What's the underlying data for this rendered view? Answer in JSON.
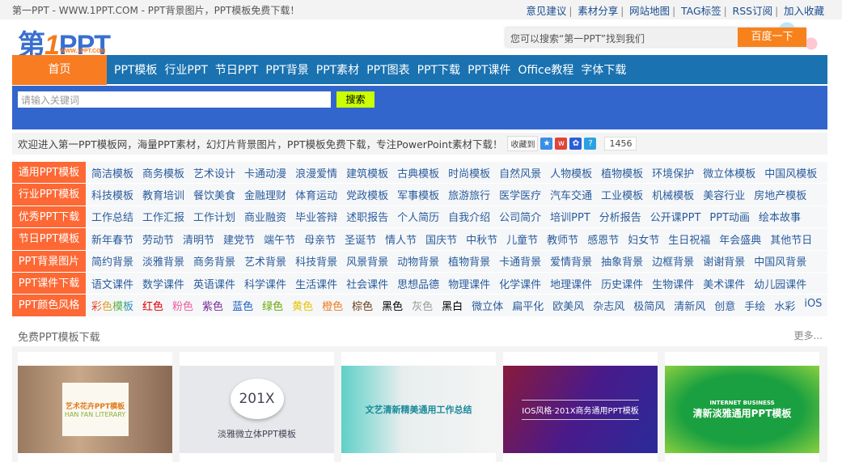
{
  "topbar": {
    "title": "第一PPT - WWW.1PPT.COM - PPT背景图片，PPT模板免费下载！",
    "links": [
      "意见建议",
      "素材分享",
      "网站地图",
      "TAG标签",
      "RSS订阅",
      "加入收藏"
    ]
  },
  "logo": {
    "text_a": "第",
    "text_b": "1",
    "text_c": "PPT",
    "sub": "WWW.1PPT.COM"
  },
  "baidu": {
    "placeholder": "您可以搜索“第一PPT”找到我们",
    "button": "百度一下"
  },
  "nav": {
    "home": "首页",
    "items": [
      "PPT模板",
      "行业PPT",
      "节日PPT",
      "PPT背景",
      "PPT素材",
      "PPT图表",
      "PPT下载",
      "PPT课件",
      "Office教程",
      "字体下载"
    ]
  },
  "search": {
    "placeholder": "请输入关键词",
    "button": "搜索"
  },
  "welcome": {
    "text": "欢迎进入第一PPT模板网，海量PPT素材，幻灯片背景图片，PPT模板免费下载，专注PowerPoint素材下载！",
    "fav": "收藏到",
    "count": "1456"
  },
  "categories": [
    {
      "label": "通用PPT模板",
      "links": [
        "简洁模板",
        "商务模板",
        "艺术设计",
        "卡通动漫",
        "浪漫爱情",
        "建筑模板",
        "古典模板",
        "时尚模板",
        "自然风景",
        "人物模板",
        "植物模板",
        "环境保护",
        "微立体模板",
        "中国风模板"
      ]
    },
    {
      "label": "行业PPT模板",
      "links": [
        "科技模板",
        "教育培训",
        "餐饮美食",
        "金融理财",
        "体育运动",
        "党政模板",
        "军事模板",
        "旅游旅行",
        "医学医疗",
        "汽车交通",
        "工业模板",
        "机械模板",
        "美容行业",
        "房地产模板"
      ]
    },
    {
      "label": "优秀PPT下载",
      "links": [
        "工作总结",
        "工作汇报",
        "工作计划",
        "商业融资",
        "毕业答辩",
        "述职报告",
        "个人简历",
        "自我介绍",
        "公司简介",
        "培训PPT",
        "分析报告",
        "公开课PPT",
        "PPT动画",
        "绘本故事"
      ]
    },
    {
      "label": "节日PPT模板",
      "links": [
        "新年春节",
        "劳动节",
        "清明节",
        "建党节",
        "端午节",
        "母亲节",
        "圣诞节",
        "情人节",
        "国庆节",
        "中秋节",
        "儿童节",
        "教师节",
        "感恩节",
        "妇女节",
        "生日祝福",
        "年会盛典",
        "其他节日"
      ]
    },
    {
      "label": "PPT背景图片",
      "links": [
        "简约背景",
        "淡雅背景",
        "商务背景",
        "艺术背景",
        "科技背景",
        "风景背景",
        "动物背景",
        "植物背景",
        "卡通背景",
        "爱情背景",
        "抽象背景",
        "边框背景",
        "谢谢背景",
        "中国风背景"
      ]
    },
    {
      "label": "PPT课件下载",
      "links": [
        "语文课件",
        "数学课件",
        "英语课件",
        "科学课件",
        "生活课件",
        "社会课件",
        "思想品德",
        "物理课件",
        "化学课件",
        "地理课件",
        "历史课件",
        "生物课件",
        "美术课件",
        "幼儿园课件"
      ]
    }
  ],
  "colors": {
    "label": "PPT颜色风格",
    "links": [
      {
        "text": "彩色模板",
        "color": "#d0342c"
      },
      {
        "text": "红色",
        "color": "#e00000"
      },
      {
        "text": "粉色",
        "color": "#ee5aa0"
      },
      {
        "text": "紫色",
        "color": "#7a2a9a"
      },
      {
        "text": "蓝色",
        "color": "#1a5fc0"
      },
      {
        "text": "绿色",
        "color": "#66a800"
      },
      {
        "text": "黄色",
        "color": "#e8c400"
      },
      {
        "text": "橙色",
        "color": "#f07a20"
      },
      {
        "text": "棕色",
        "color": "#6b3e1a"
      },
      {
        "text": "黑色",
        "color": "#000000"
      },
      {
        "text": "灰色",
        "color": "#999999"
      },
      {
        "text": "黑白",
        "color": "#000000"
      },
      {
        "text": "微立体",
        "color": "#2a5c9a"
      },
      {
        "text": "扁平化",
        "color": "#2a5c9a"
      },
      {
        "text": "欧美风",
        "color": "#2a5c9a"
      },
      {
        "text": "杂志风",
        "color": "#2a5c9a"
      },
      {
        "text": "极简风",
        "color": "#2a5c9a"
      },
      {
        "text": "清新风",
        "color": "#2a5c9a"
      },
      {
        "text": "创意",
        "color": "#2a5c9a"
      },
      {
        "text": "手绘",
        "color": "#2a5c9a"
      },
      {
        "text": "水彩",
        "color": "#2a5c9a"
      },
      {
        "text": "iOS",
        "color": "#2a5c9a"
      }
    ]
  },
  "section": {
    "title": "免费PPT模板下载",
    "more": "更多..."
  },
  "cards": [
    {
      "title": "艺术花卉PPT模板",
      "sub": "HAN FAN LITERARY"
    },
    {
      "title": "201X",
      "sub": "淡雅微立体PPT模板"
    },
    {
      "title": "文艺清新精美通用工作总结",
      "sub": ""
    },
    {
      "title": "IOS风格·201X商务通用PPT模板",
      "sub": ""
    },
    {
      "title": "清新淡雅通用PPT模板",
      "sub": "INTERNET BUSINESS"
    }
  ]
}
